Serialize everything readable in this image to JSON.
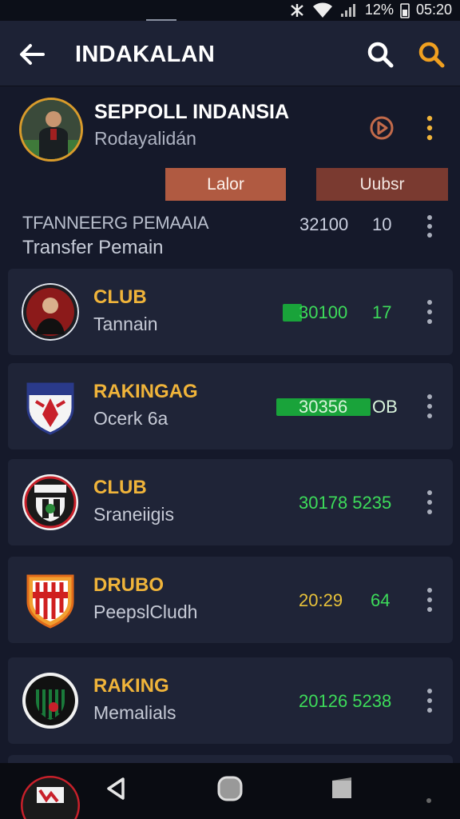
{
  "status_bar": {
    "battery_text": "12%",
    "time": "05:20"
  },
  "app_bar": {
    "title": "INDAKALAN",
    "back_icon": "arrow-left-icon",
    "search_icon": "search-icon",
    "search_icon_accent": "search-icon"
  },
  "profile": {
    "name": "SEPPOLL INDANSIA",
    "subtitle": "Rodayalidán",
    "button_left": "Lalor",
    "button_right": "Uubsr"
  },
  "section": {
    "title": "TFANNEERG PEMAAIA",
    "subtitle": "Transfer Pemain",
    "value1": "32100",
    "value2": "10"
  },
  "rows": [
    {
      "title": "CLUB",
      "subtitle": "Tannain",
      "value1": "30100",
      "value2": "17"
    },
    {
      "title": "RAKINGAG",
      "subtitle": "Ocerk 6a",
      "value1": "30356",
      "value2": "OB"
    },
    {
      "title": "CLUB",
      "subtitle": "Sraneiigis",
      "value1": "30178 5235",
      "value2": ""
    },
    {
      "title": "DRUBO",
      "subtitle": "PeepslCludh",
      "value1": "20:29",
      "value2": "64"
    },
    {
      "title": "RAKING",
      "subtitle": "Memalials",
      "value1": "20126 5238",
      "value2": ""
    }
  ],
  "colors": {
    "accent_orange": "#f0b43a",
    "value_green": "#3ddc5a",
    "value_yellow": "#e8c23a",
    "button_left": "#b05a41",
    "button_right": "#7a3a30"
  }
}
